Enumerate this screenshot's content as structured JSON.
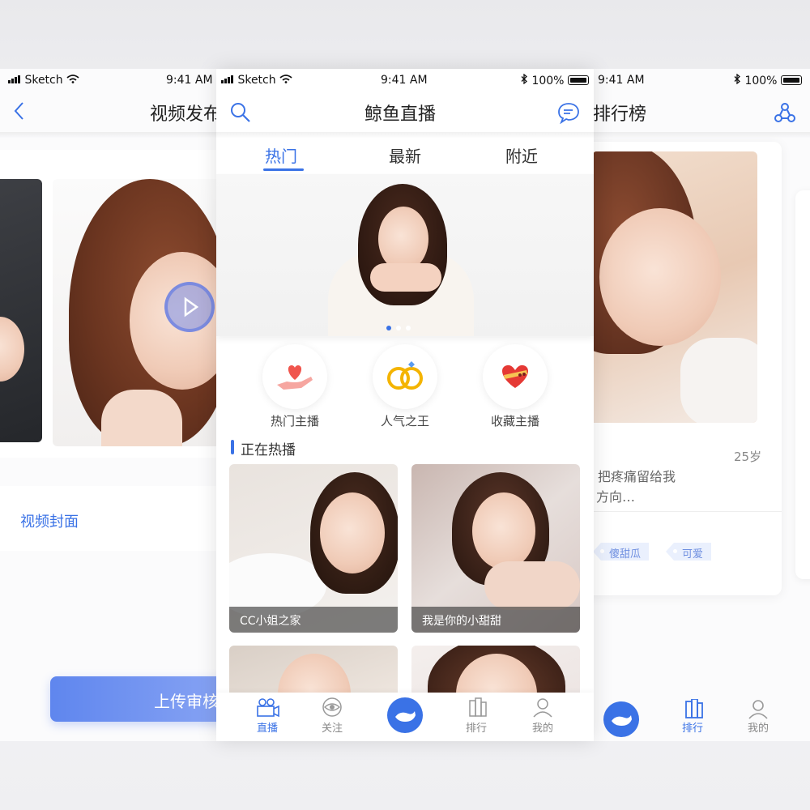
{
  "left_screen": {
    "status": {
      "carrier": "Sketch",
      "time": "9:41 AM"
    },
    "title": "视频发布",
    "cover_label": "视频封面",
    "upload_button": "上传审核"
  },
  "center_screen": {
    "status": {
      "carrier": "Sketch",
      "time": "9:41 AM",
      "battery": "100%"
    },
    "title": "鲸鱼直播",
    "tabs": [
      {
        "label": "热门",
        "active": true
      },
      {
        "label": "最新",
        "active": false
      },
      {
        "label": "附近",
        "active": false
      }
    ],
    "categories": [
      {
        "label": "热门主播",
        "icon": "heart-hand-icon"
      },
      {
        "label": "人气之王",
        "icon": "rings-icon"
      },
      {
        "label": "收藏主播",
        "icon": "heart-box-icon"
      }
    ],
    "section_title": "正在热播",
    "streams": [
      {
        "caption": "CC小姐之家"
      },
      {
        "caption": "我是你的小甜甜"
      },
      {
        "caption": ""
      },
      {
        "caption": ""
      }
    ],
    "tabbar": [
      {
        "label": "直播",
        "icon": "video-camera-icon",
        "active": true
      },
      {
        "label": "关注",
        "icon": "eye-icon",
        "active": false
      },
      {
        "label": "",
        "icon": "whale-icon",
        "active": false
      },
      {
        "label": "排行",
        "icon": "ranking-icon",
        "active": false
      },
      {
        "label": "我的",
        "icon": "user-icon",
        "active": false
      }
    ]
  },
  "right_screen": {
    "status": {
      "time": "9:41 AM",
      "battery": "100%"
    },
    "title": "排行榜",
    "age": "25岁",
    "bio_line1": "把疼痛留给我",
    "bio_line2": "方向…",
    "tags": [
      "傻甜瓜",
      "可爱"
    ],
    "tabbar": [
      {
        "label": "排行",
        "active": true
      },
      {
        "label": "我的",
        "active": false
      }
    ]
  },
  "colors": {
    "accent": "#3a72e6",
    "upload_gradient_start": "#5f86ee",
    "upload_gradient_end": "#8fa9f5"
  }
}
